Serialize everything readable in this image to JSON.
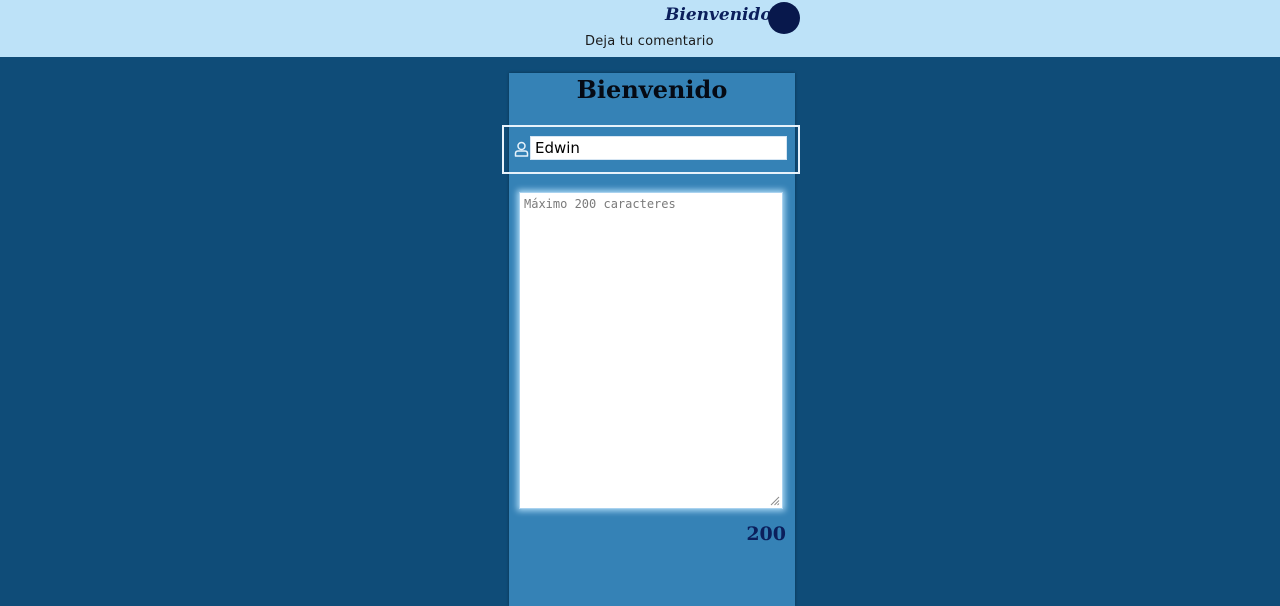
{
  "header": {
    "brand": "Bienvenido",
    "subtitle": "Deja tu comentario",
    "avatar_color": "#08184c"
  },
  "card": {
    "title": "Bienvenido",
    "name_field": {
      "icon": "user-icon",
      "value": "Edwin"
    },
    "comment_field": {
      "placeholder": "Máximo 200 caracteres",
      "value": ""
    },
    "remaining_characters": "200"
  },
  "colors": {
    "page_background": "#0f4c78",
    "header_background": "#bde2f8",
    "card_background": "#3582b6",
    "accent_text": "#0b1f5c"
  }
}
